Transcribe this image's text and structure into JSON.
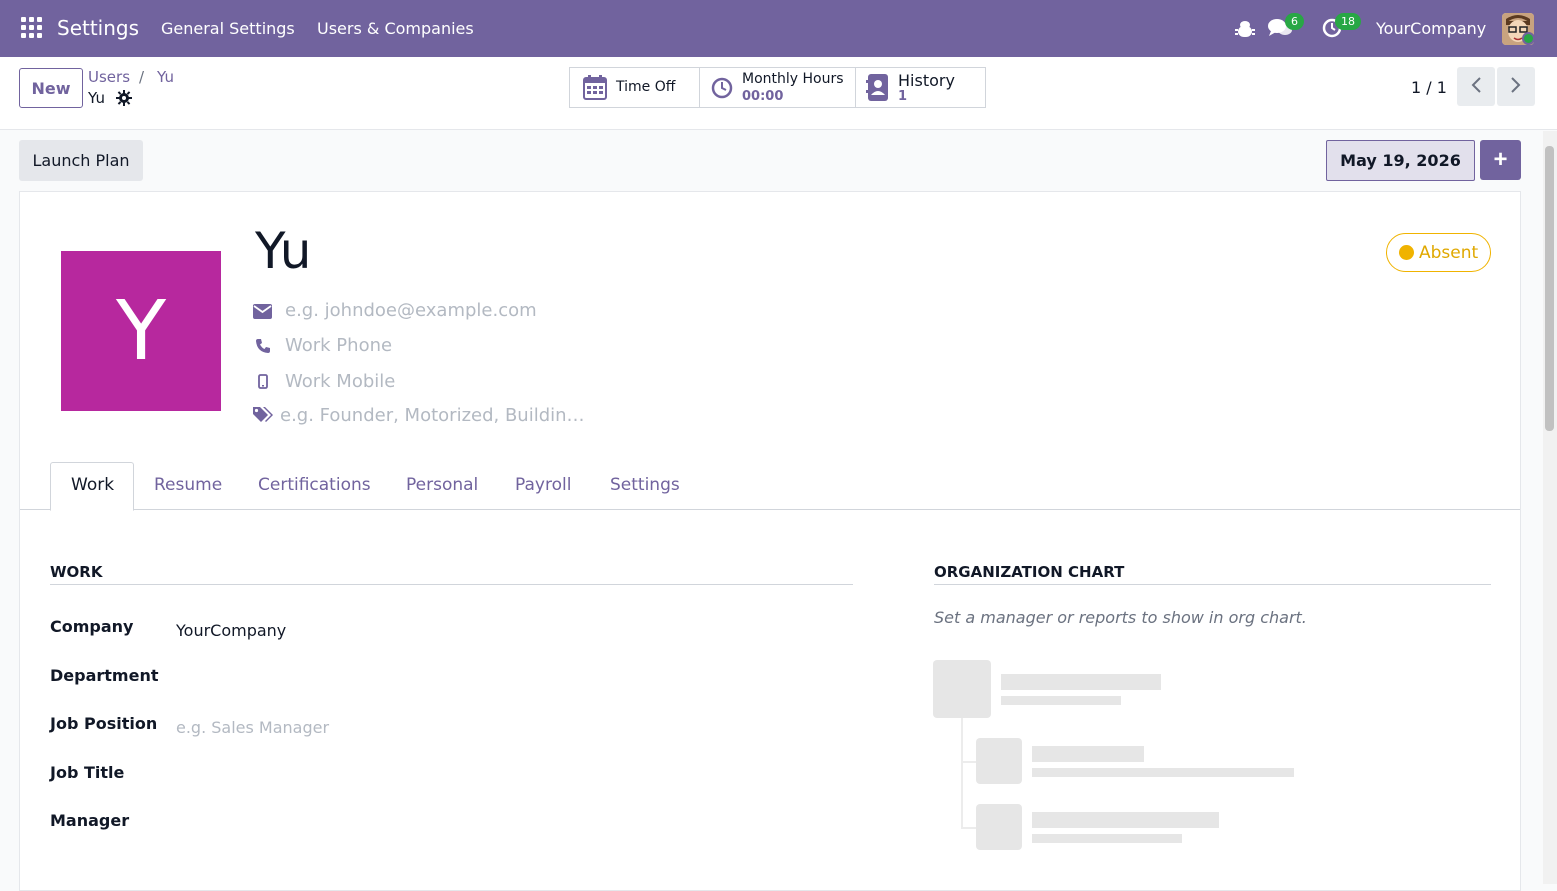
{
  "navbar": {
    "brand": "Settings",
    "menu": [
      "General Settings",
      "Users & Companies"
    ],
    "chat_count": "6",
    "activity_count": "18",
    "company": "YourCompany"
  },
  "control": {
    "new_label": "New",
    "breadcrumb_users": "Users",
    "breadcrumb_sep": "/",
    "breadcrumb_yu": "Yu",
    "current": "Yu",
    "stats": {
      "time_off": "Time Off",
      "monthly_hours_label": "Monthly Hours",
      "monthly_hours_value": "00:00",
      "history_label": "History",
      "history_value": "1"
    },
    "pager": "1 / 1"
  },
  "actions": {
    "launch_plan": "Launch Plan",
    "date": "May 19, 2026",
    "plus": "+"
  },
  "employee": {
    "initial": "Y",
    "name": "Yu",
    "status": "Absent",
    "email_placeholder": "e.g. johndoe@example.com",
    "work_phone_placeholder": "Work Phone",
    "work_mobile_placeholder": "Work Mobile",
    "tags_placeholder": "e.g. Founder, Motorized, Buildin…"
  },
  "tabs": [
    "Work",
    "Resume",
    "Certifications",
    "Personal",
    "Payroll",
    "Settings"
  ],
  "work": {
    "title": "WORK",
    "company_label": "Company",
    "company_value": "YourCompany",
    "department_label": "Department",
    "job_position_label": "Job Position",
    "job_position_placeholder": "e.g. Sales Manager",
    "job_title_label": "Job Title",
    "manager_label": "Manager"
  },
  "org_chart": {
    "title": "ORGANIZATION CHART",
    "help": "Set a manager or reports to show in org chart."
  },
  "colors": {
    "brand": "#71639e",
    "avatar": "#b7289e",
    "absent": "#f0b300",
    "badge": "#28a745"
  }
}
